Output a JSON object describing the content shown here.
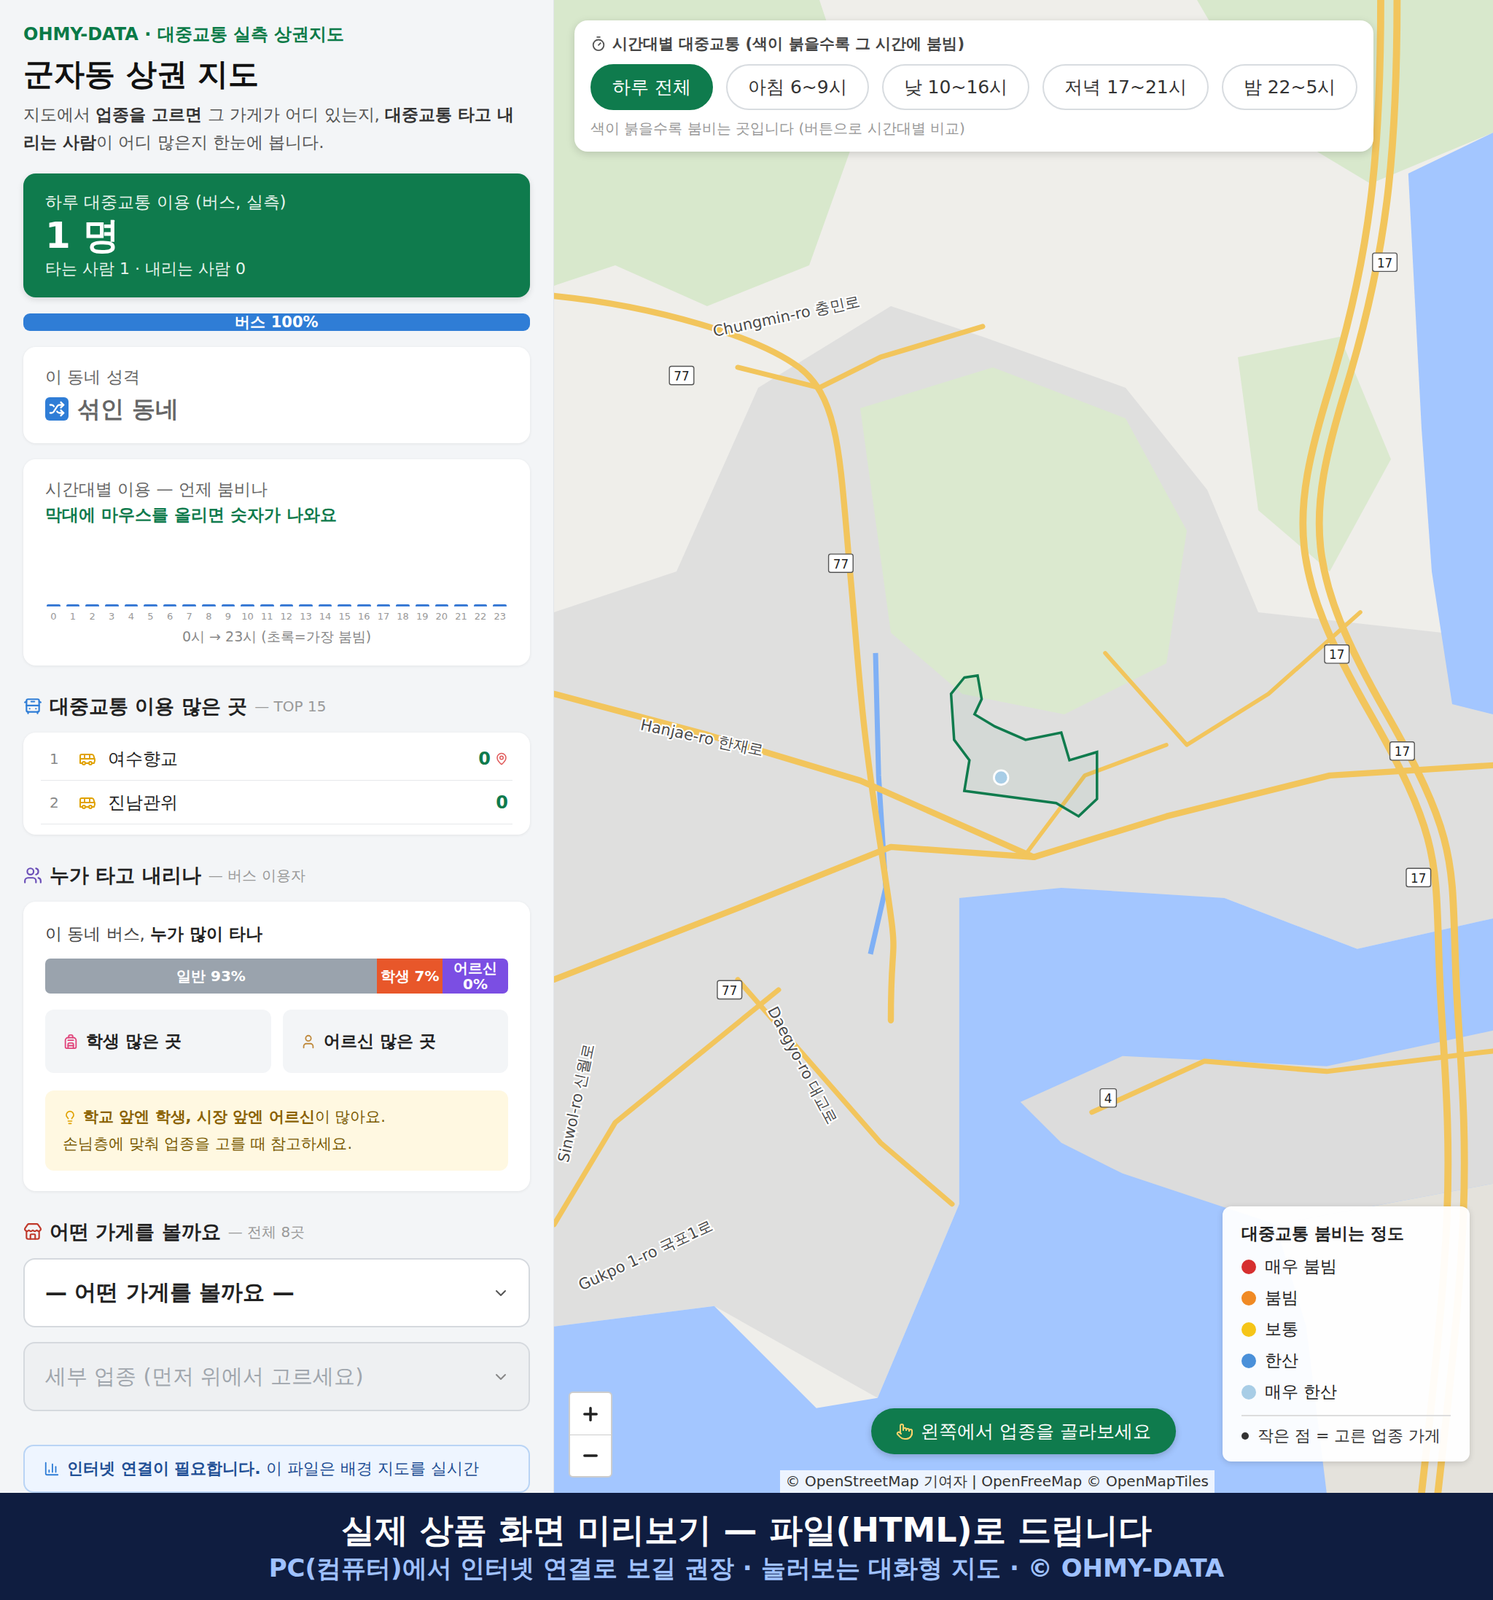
{
  "brand": "OHMY-DATA · 대중교통 실측 상권지도",
  "title": "군자동 상권 지도",
  "intro": [
    {
      "text": "지도에서 ",
      "bold": false
    },
    {
      "text": "업종을 고르면",
      "bold": true
    },
    {
      "text": " 그 가게가 어디 있는지, ",
      "bold": false
    },
    {
      "text": "대중교통 타고 내리는 사람",
      "bold": true
    },
    {
      "text": "이 어디 많은지 한눈에 봅니다.",
      "bold": false
    }
  ],
  "ridership": {
    "label": "하루 대중교통 이용 (버스, 실측)",
    "value": "1 명",
    "detail": "타는 사람 1 · 내리는 사람 0"
  },
  "mode_bar": [
    {
      "label": "버스 100%",
      "level": 1,
      "color": "#2f7dd6"
    }
  ],
  "character": {
    "label": "이 동네 성격",
    "value": "섞인 동네"
  },
  "hourly": {
    "title": "시간대별 이용 — 언제 붐비나",
    "hint": "막대에 마우스를 올리면 숫자가 나와요",
    "values": [
      0,
      0,
      0,
      0,
      0,
      0,
      0,
      0,
      0,
      0,
      0,
      0,
      0,
      0,
      0,
      0,
      0,
      0,
      0,
      0,
      0,
      0,
      0,
      0
    ],
    "ticks": [
      "0",
      "1",
      "2",
      "3",
      "4",
      "5",
      "6",
      "7",
      "8",
      "9",
      "10",
      "11",
      "12",
      "13",
      "14",
      "15",
      "16",
      "17",
      "18",
      "19",
      "20",
      "21",
      "22",
      "23"
    ],
    "caption": "0시 → 23시 (초록=가장 붐빔)"
  },
  "top_stops": {
    "title": "대중교통 이용 많은 곳",
    "note": "— TOP 15",
    "rows": [
      {
        "rank": "1",
        "name": "여수향교",
        "count": "0",
        "pinned": true
      },
      {
        "rank": "2",
        "name": "진남관위",
        "count": "0",
        "pinned": false
      }
    ]
  },
  "riders": {
    "title": "누가 타고 내리나",
    "note": "— 버스 이용자",
    "question": [
      {
        "text": "이 동네 버스, ",
        "bold": false
      },
      {
        "text": "누가 많이 타나",
        "bold": true
      }
    ],
    "segments": [
      {
        "label": "일반 93%",
        "level": 0.93,
        "color": "#9aa3ad"
      },
      {
        "label": "학생 7%",
        "level": 0.07,
        "color": "#e8572a"
      },
      {
        "label": "어르신 0%",
        "level": 0,
        "color": "#7b4ee3"
      }
    ],
    "buttons": [
      "학생 많은 곳",
      "어르신 많은 곳"
    ],
    "tip_line1": [
      {
        "text": "학교 앞엔 학생, 시장 앞엔 어르신",
        "bold": true
      },
      {
        "text": "이 많아요.",
        "bold": false
      }
    ],
    "tip_line2": "손님층에 맞춰 업종을 고를 때 참고하세요."
  },
  "stores": {
    "title": "어떤 가게를 볼까요",
    "note": "— 전체 8곳",
    "category": {
      "value": "— 어떤 가게를 볼까요 —",
      "disabled": false
    },
    "subcategory": {
      "placeholder": "세부 업종 (먼저 위에서 고르세요)",
      "disabled": true
    }
  },
  "notice": [
    {
      "text": "인터넷 연결이 필요합니다.",
      "bold": true
    },
    {
      "text": " 이 파일은 배경 지도를 실시간",
      "bold": false
    }
  ],
  "time_filter": {
    "title": "시간대별 대중교통 (색이 붉을수록 그 시간에 붐빔)",
    "options": [
      {
        "label": "하루 전체",
        "selected": true
      },
      {
        "label": "아침 6~9시",
        "selected": false
      },
      {
        "label": "낮 10~16시",
        "selected": false
      },
      {
        "label": "저녁 17~21시",
        "selected": false
      },
      {
        "label": "밤 22~5시",
        "selected": false
      }
    ],
    "hint": "색이 붉을수록 붐비는 곳입니다 (버튼으로 시간대별 비교)"
  },
  "legend": {
    "title": "대중교통 붐비는 정도",
    "items": [
      {
        "label": "매우 붐빔",
        "color": "#d62f2f"
      },
      {
        "label": "붐빔",
        "color": "#f08a24"
      },
      {
        "label": "보통",
        "color": "#f5c518"
      },
      {
        "label": "한산",
        "color": "#4a90d9"
      },
      {
        "label": "매우 한산",
        "color": "#a8cde6"
      }
    ],
    "note": "작은 점 = 고른 업종 가게"
  },
  "map": {
    "road_labels": [
      "Chungmin-ro 충민로",
      "Hanjae-ro 한재로",
      "Daegyo-ro 대교로",
      "Sinwol-ro 신월로",
      "Gukpo 1-ro 국포1로"
    ],
    "route_shields": [
      "17",
      "17",
      "17",
      "17",
      "77",
      "77",
      "77",
      "4"
    ],
    "attribution": "© OpenStreetMap 기여자 | OpenFreeMap © OpenMapTiles"
  },
  "prompt": "왼쪽에서 업종을 골라보세요",
  "banner": {
    "headline": "실제 상품 화면 미리보기 — 파일(HTML)로 드립니다",
    "subline": "PC(컴퓨터)에서 인터넷 연결로 보길 권장 · 눌러보는 대화형 지도 · © OHMY-DATA"
  }
}
